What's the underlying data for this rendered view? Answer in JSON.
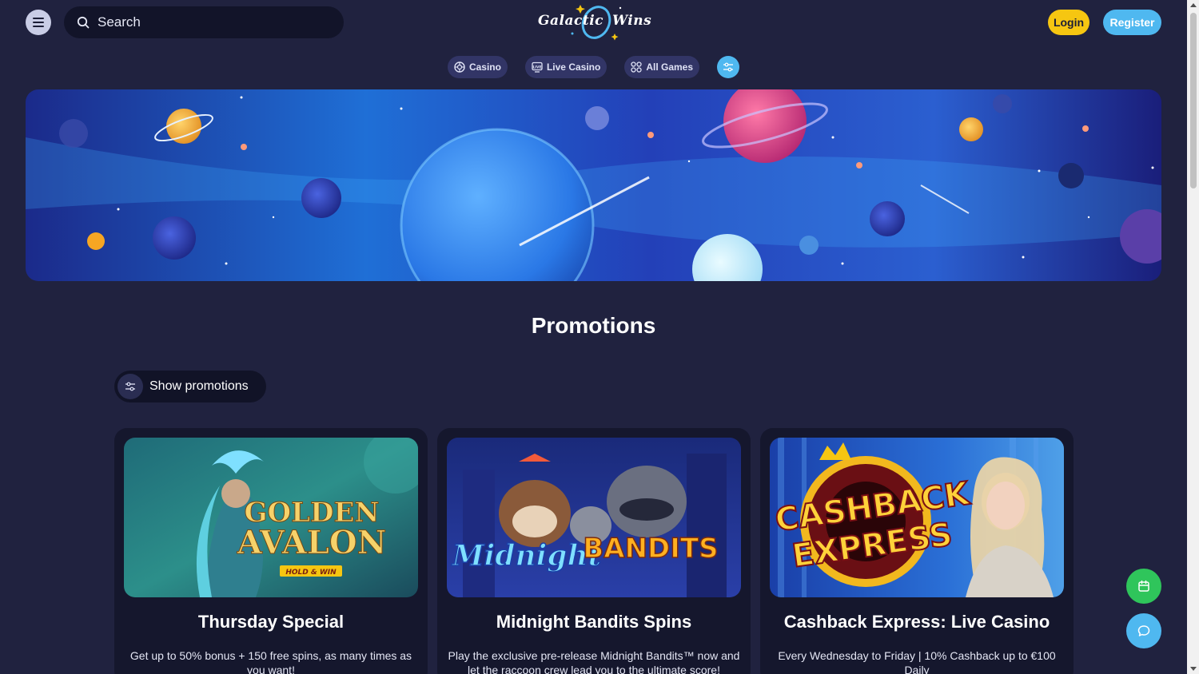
{
  "header": {
    "search_placeholder": "Search",
    "logo_word_1": "Galactic",
    "logo_word_2": "Wins",
    "login_label": "Login",
    "register_label": "Register"
  },
  "categories": [
    {
      "label": "Casino",
      "icon": "casino-chip-icon"
    },
    {
      "label": "Live Casino",
      "icon": "live-tv-icon"
    },
    {
      "label": "All Games",
      "icon": "grid-icon"
    }
  ],
  "page": {
    "title": "Promotions",
    "show_promotions_label": "Show promotions"
  },
  "promotions": [
    {
      "title": "Thursday Special",
      "description": "Get up to 50% bonus + 150 free spins, as many times as you want!",
      "image_title_line1": "GOLDEN",
      "image_title_line2": "AVALON",
      "image_badge": "HOLD & WIN"
    },
    {
      "title": "Midnight Bandits Spins",
      "description": "Play the exclusive pre-release Midnight Bandits™ now and let the raccoon crew lead you to the ultimate score!",
      "image_title_line1": "Midnight",
      "image_title_line2": "BANDITS"
    },
    {
      "title": "Cashback Express: Live Casino",
      "description": "Every Wednesday to Friday | 10% Cashback up to €100 Daily",
      "image_title_line1": "CASHBACK",
      "image_title_line2": "EXPRESS"
    }
  ],
  "colors": {
    "background": "#20223f",
    "login": "#f6c611",
    "register": "#4fb8f0",
    "calendar_fab": "#2fc55b",
    "chat_fab": "#4fb8f0"
  }
}
